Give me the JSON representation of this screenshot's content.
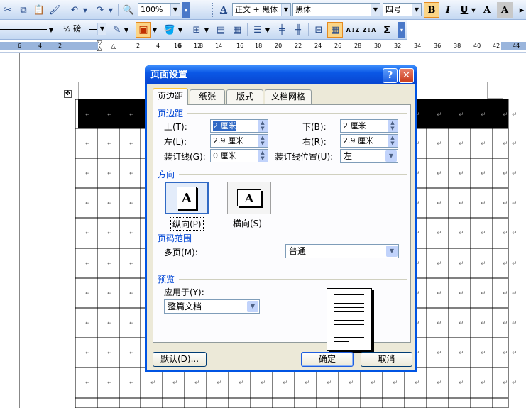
{
  "toolbar1": {
    "zoom": "100%",
    "style": "正文 + 黑体",
    "font": "黑体",
    "size": "四号",
    "bold": "B",
    "italic": "I",
    "underline": "U",
    "font_color": "A",
    "char_shading": "A"
  },
  "toolbar2": {
    "line_weight": "½ 磅",
    "sort": "A↓Z",
    "sum": "Σ"
  },
  "ruler": {
    "left_numbers": [
      "6",
      "4",
      "2"
    ],
    "right_numbers": [
      "2",
      "4",
      "6",
      "8",
      "10",
      "12",
      "14",
      "16",
      "18",
      "20",
      "22",
      "24",
      "26",
      "28",
      "30",
      "32",
      "34",
      "36",
      "38",
      "40",
      "42",
      "44"
    ]
  },
  "dialog": {
    "title": "页面设置",
    "tabs": [
      "页边距",
      "纸张",
      "版式",
      "文档网格"
    ],
    "margins_section": "页边距",
    "top_label": "上(T):",
    "top_value": "2 厘米",
    "bottom_label": "下(B):",
    "bottom_value": "2 厘米",
    "left_label": "左(L):",
    "left_value": "2.9 厘米",
    "right_label": "右(R):",
    "right_value": "2.9 厘米",
    "gutter_label": "装订线(G):",
    "gutter_value": "0 厘米",
    "gutter_pos_label": "装订线位置(U):",
    "gutter_pos_value": "左",
    "orientation_section": "方向",
    "portrait_label": "纵向(P)",
    "landscape_label": "横向(S)",
    "pages_section": "页码范围",
    "multiple_pages_label": "多页(M):",
    "multiple_pages_value": "普通",
    "preview_section": "预览",
    "apply_to_label": "应用于(Y):",
    "apply_to_value": "整篇文档",
    "default_button": "默认(D)...",
    "ok_button": "确定",
    "cancel_button": "取消",
    "help_button": "?",
    "close_button": "✕"
  },
  "document": {
    "cell_mark": "↵"
  }
}
